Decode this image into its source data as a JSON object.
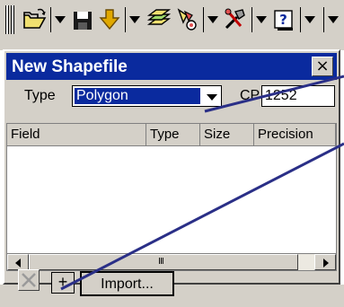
{
  "dialog": {
    "title": "New Shapefile",
    "close_label": "×"
  },
  "type_field": {
    "label": "Type",
    "value": "Polygon"
  },
  "cp_field": {
    "label": "CP",
    "value": "1252"
  },
  "table": {
    "columns": [
      "Field",
      "Type",
      "Size",
      "Precision"
    ]
  },
  "scrollbar": {
    "thumb_grip": "III"
  },
  "buttons": {
    "add_label": "+",
    "import_label": "Import..."
  },
  "colors": {
    "titlebar": "#0a2a9e",
    "face": "#d4d0c8",
    "callout_line": "#2a2f87"
  },
  "icons": {
    "toolbar": [
      "open-folder-icon",
      "save-icon",
      "download-arrow-icon",
      "layers-icon",
      "layer-add-icon",
      "tools-icon",
      "help-icon"
    ]
  }
}
